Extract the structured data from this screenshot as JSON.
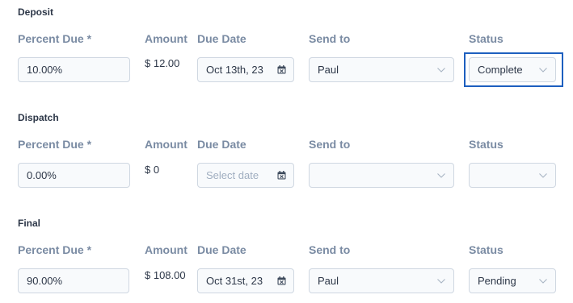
{
  "labels": {
    "percent_due": "Percent Due *",
    "amount": "Amount",
    "due_date": "Due Date",
    "send_to": "Send to",
    "status": "Status"
  },
  "sections": [
    {
      "title": "Deposit",
      "percent_due": "10.00%",
      "amount": "$ 12.00",
      "due_date": "Oct 13th, 23",
      "due_date_is_placeholder": false,
      "send_to": "Paul",
      "status": "Complete",
      "status_focused": true
    },
    {
      "title": "Dispatch",
      "percent_due": "0.00%",
      "amount": "$ 0",
      "due_date": "Select date",
      "due_date_is_placeholder": true,
      "send_to": "",
      "status": "",
      "status_focused": false
    },
    {
      "title": "Final",
      "percent_due": "90.00%",
      "amount": "$ 108.00",
      "due_date": "Oct 31st, 23",
      "due_date_is_placeholder": false,
      "send_to": "Paul",
      "status": "Pending",
      "status_focused": false
    }
  ],
  "colors": {
    "label": "#7a8ba3",
    "field_border": "#cfd7e1",
    "field_bg": "#f8fafc",
    "focus": "#1d5fbf",
    "icon": "#3d4a5c",
    "placeholder": "#a0aec0"
  },
  "icons": {
    "date": "calendar-icon",
    "select": "chevron-down-icon"
  }
}
